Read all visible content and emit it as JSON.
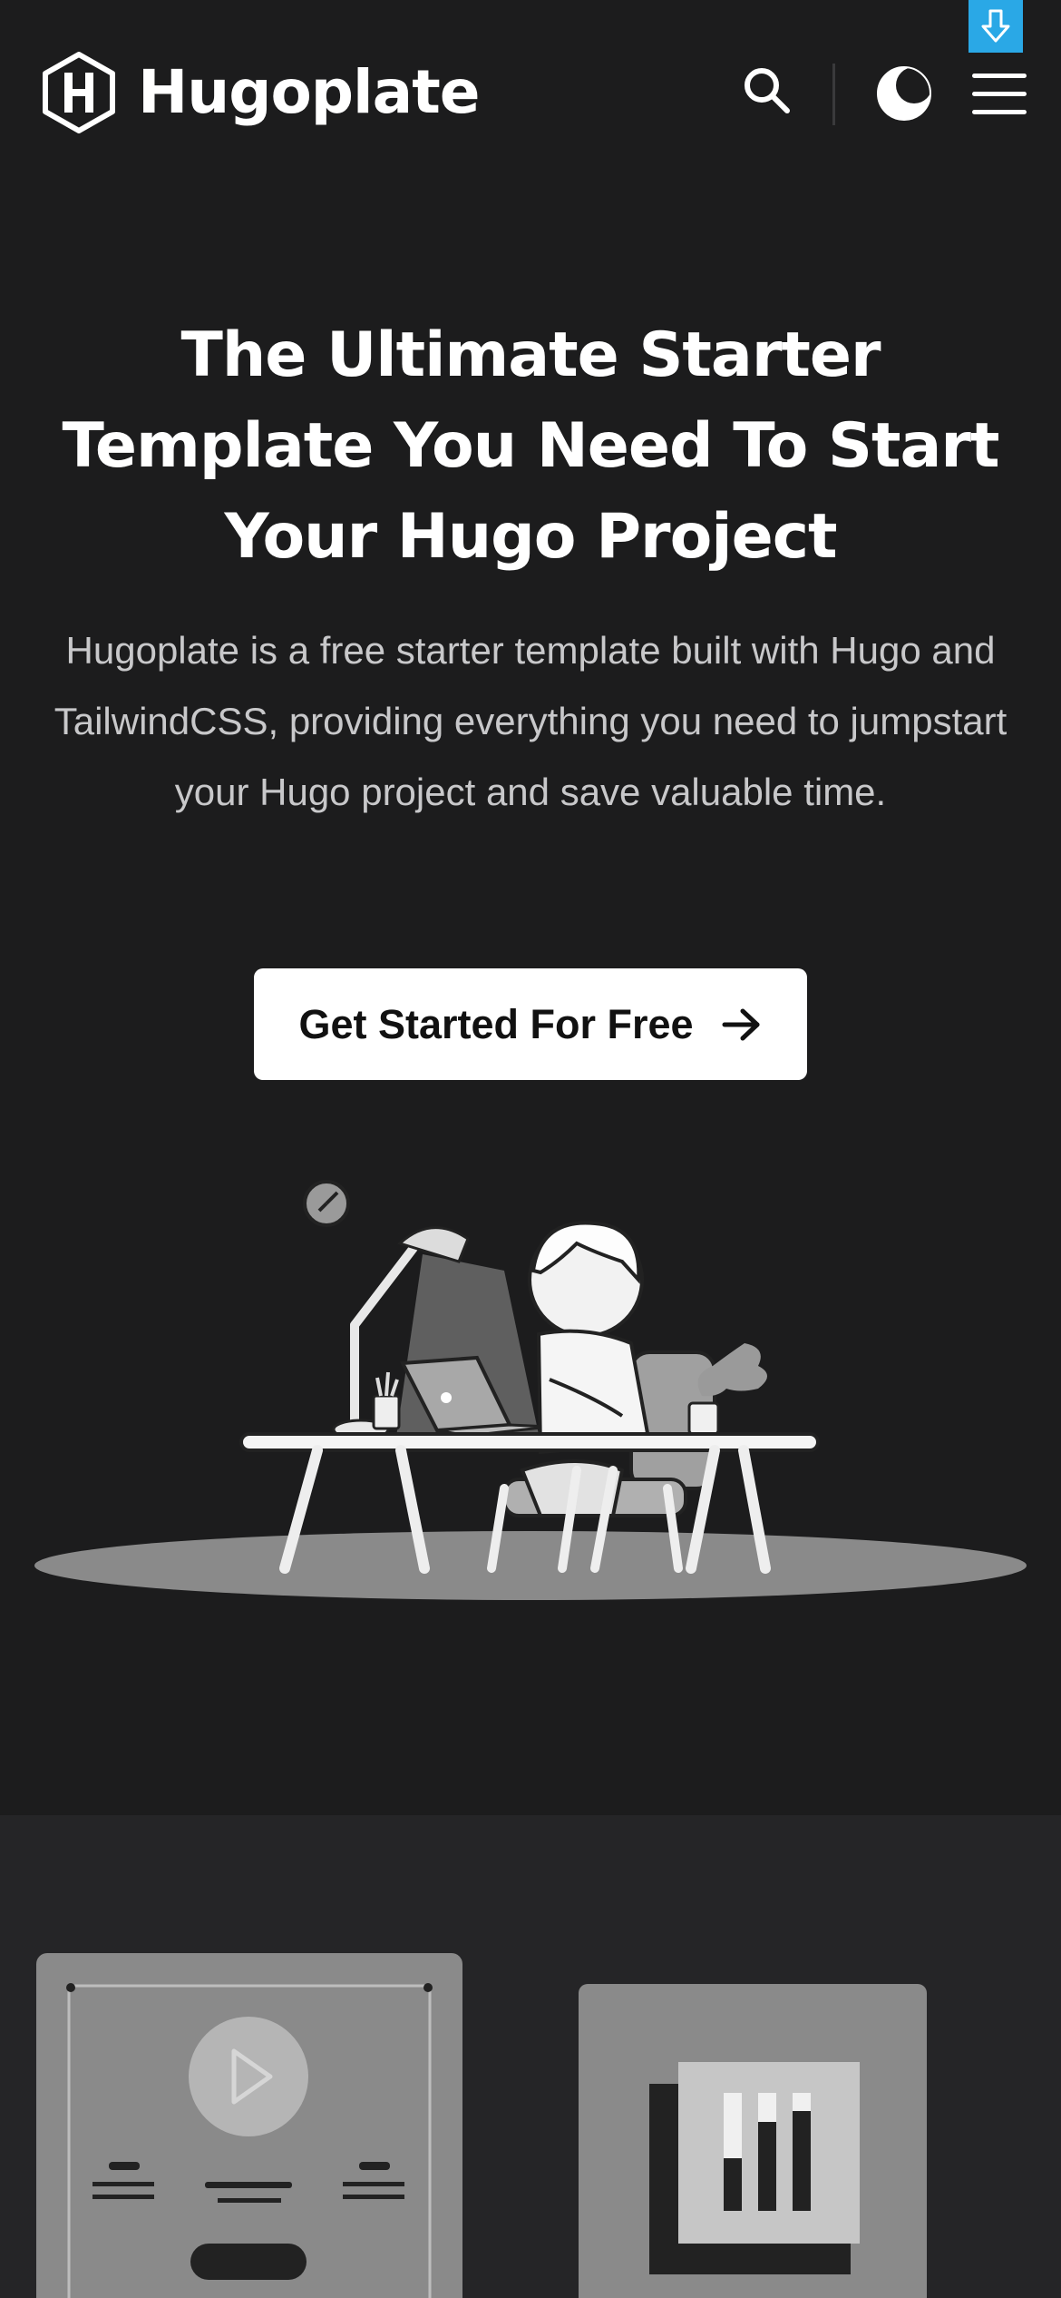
{
  "header": {
    "brand": "Hugoplate",
    "icons": {
      "logo": "hexagon-h-logo",
      "search": "search-icon",
      "theme": "moon-icon",
      "menu": "hamburger-menu-icon",
      "download": "download-arrow-icon"
    }
  },
  "hero": {
    "title": "The Ultimate Starter Template You Need To Start Your Hugo Project",
    "description": "Hugoplate is a free starter template built with Hugo and TailwindCSS, providing everything you need to jumpstart your Hugo project and save valuable time.",
    "cta_label": "Get Started For Free",
    "cta_icon": "arrow-right-icon"
  },
  "colors": {
    "background": "#1c1c1d",
    "section_background": "#252527",
    "text": "#ffffff",
    "muted_text": "#c8c8ca",
    "accent_badge": "#2aa8e6",
    "button_background": "#ffffff"
  }
}
